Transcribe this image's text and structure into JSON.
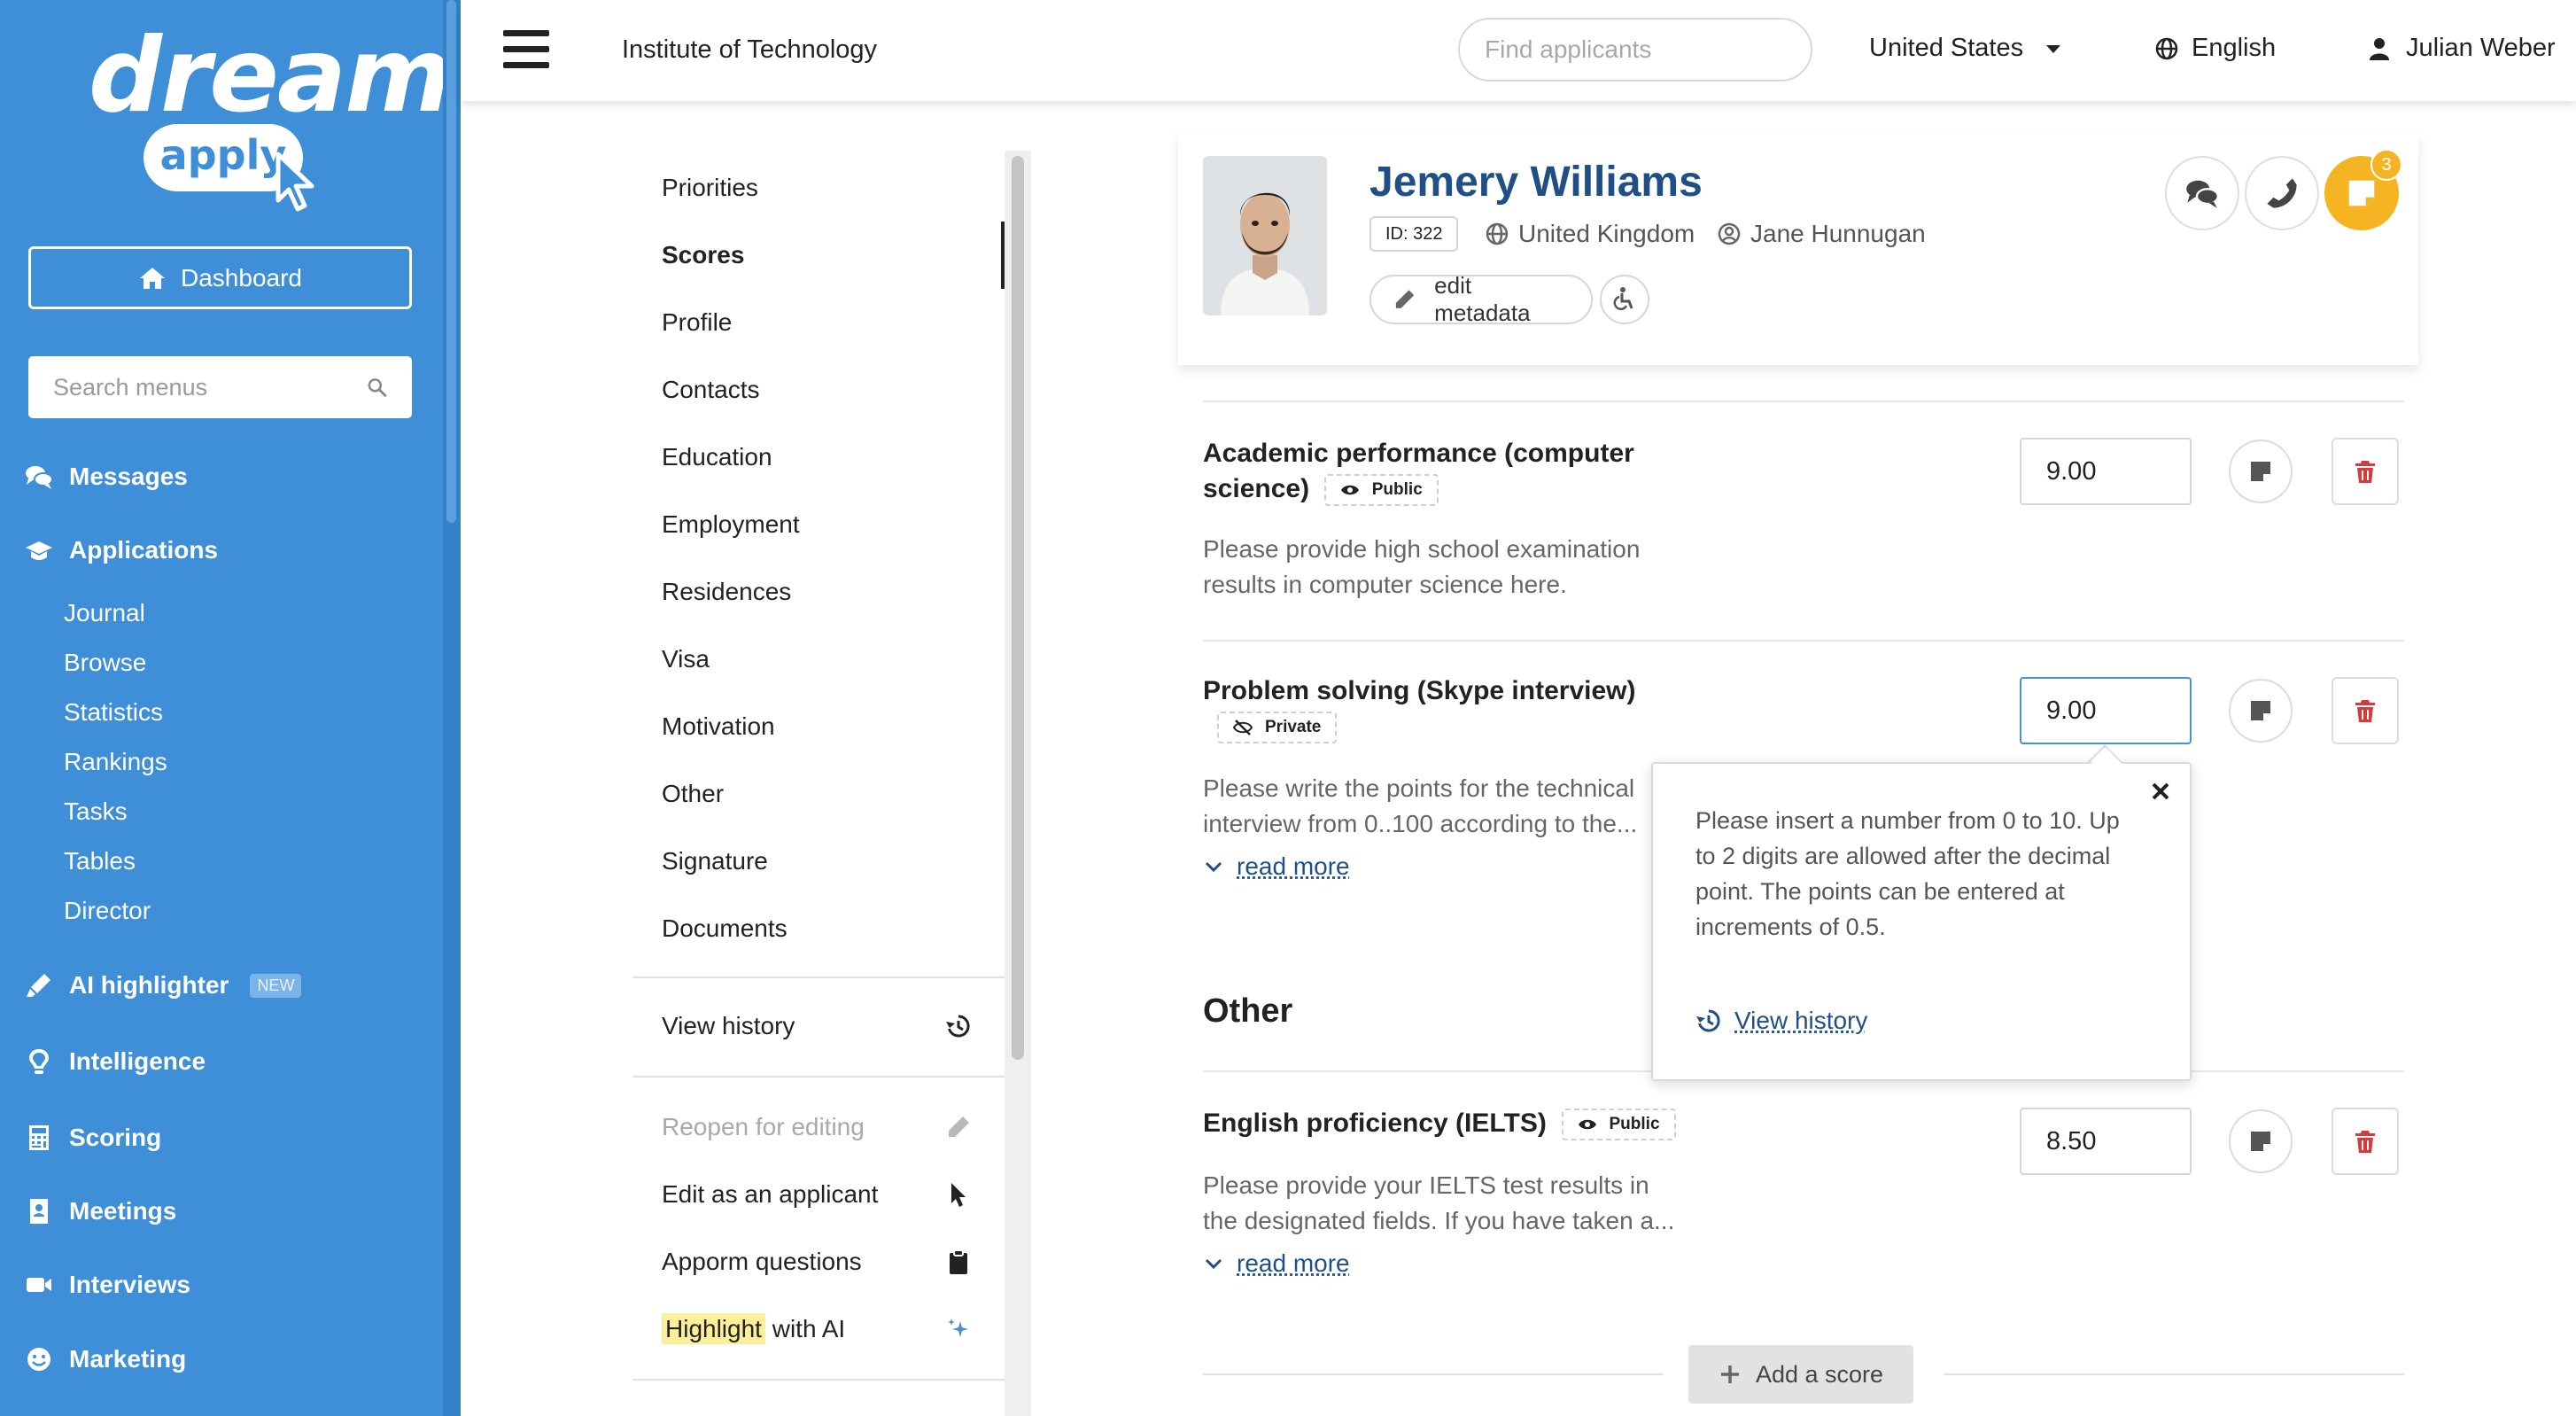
{
  "brand": {
    "word": "dream",
    "sub": "apply",
    "accent": "#3e8ed8"
  },
  "sidebar": {
    "dashboard_label": "Dashboard",
    "search_placeholder": "Search menus",
    "items": [
      {
        "label": "Messages",
        "icon": "comments-icon"
      },
      {
        "label": "Applications",
        "icon": "graduation-cap-icon"
      },
      {
        "label": "AI highlighter",
        "icon": "highlighter-icon",
        "badge": "NEW"
      },
      {
        "label": "Intelligence",
        "icon": "lightbulb-icon"
      },
      {
        "label": "Scoring",
        "icon": "calculator-icon"
      },
      {
        "label": "Meetings",
        "icon": "address-card-icon"
      },
      {
        "label": "Interviews",
        "icon": "video-icon"
      },
      {
        "label": "Marketing",
        "icon": "smile-icon"
      }
    ],
    "applications_sub": [
      "Journal",
      "Browse",
      "Statistics",
      "Rankings",
      "Tasks",
      "Tables",
      "Director"
    ]
  },
  "topbar": {
    "institution": "Institute of Technology",
    "search_placeholder": "Find applicants",
    "country": "United States",
    "language": "English",
    "user": "Julian Weber"
  },
  "section_nav": {
    "items": [
      "Priorities",
      "Scores",
      "Profile",
      "Contacts",
      "Education",
      "Employment",
      "Residences",
      "Visa",
      "Motivation",
      "Other",
      "Signature",
      "Documents"
    ],
    "active": "Scores",
    "view_history": "View history",
    "actions": [
      "Reopen for editing",
      "Edit as an applicant",
      "Apporm questions",
      "Highlight with AI"
    ],
    "highlight_word": "Highlight",
    "highlight_rest": " with AI"
  },
  "applicant": {
    "name": "Jemery Williams",
    "id": "ID: 322",
    "country": "United Kingdom",
    "assignee": "Jane Hunnugan",
    "edit_metadata": "edit metadata",
    "notification_count": "3"
  },
  "scores": [
    {
      "title_line1": "Academic performance (computer",
      "title_line2": "science)",
      "visibility": "Public",
      "desc_line1": "Please provide high school examination",
      "desc_line2": "results in computer science here.",
      "value": "9.00"
    },
    {
      "title_line1": "Problem solving (Skype interview)",
      "visibility": "Private",
      "desc_line1": "Please write the points for the technical",
      "desc_line2": "interview from 0..100 according to the...",
      "read_more": "read more",
      "value": "9.00"
    },
    {
      "title_line1": "English proficiency (IELTS)",
      "visibility": "Public",
      "desc_line1": "Please provide your IELTS test results in",
      "desc_line2": "the designated fields. If you have taken a...",
      "read_more": "read more",
      "value": "8.50"
    }
  ],
  "other_section": "Other",
  "popover": {
    "text": "Please insert a number from 0 to 10. Up to 2 digits are allowed after the decimal point. The points can be entered at increments of 0.5.",
    "history_link": "View history"
  },
  "add_score": "Add a score"
}
